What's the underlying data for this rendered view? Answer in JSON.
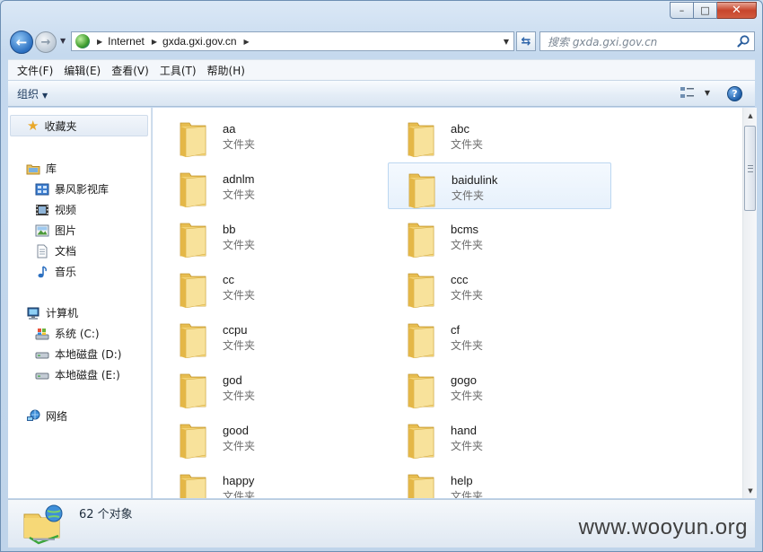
{
  "window": {
    "controls": {
      "minimize": "–",
      "maximize": "□",
      "close": "✕"
    }
  },
  "address": {
    "crumbs": [
      "Internet",
      "gxda.gxi.gov.cn"
    ],
    "search_placeholder": "搜索 gxda.gxi.gov.cn"
  },
  "menu": [
    "文件(F)",
    "编辑(E)",
    "查看(V)",
    "工具(T)",
    "帮助(H)"
  ],
  "toolbar": {
    "organize_label": "组织"
  },
  "navpane": {
    "favorites": "收藏夹",
    "libraries": {
      "label": "库",
      "items": [
        "暴风影视库",
        "视频",
        "图片",
        "文档",
        "音乐"
      ]
    },
    "computer": {
      "label": "计算机",
      "items": [
        "系统 (C:)",
        "本地磁盘 (D:)",
        "本地磁盘 (E:)"
      ]
    },
    "network": "网络"
  },
  "content": {
    "type_label": "文件夹",
    "selected_folder": "baidulink",
    "folders": [
      "aa",
      "abc",
      "adnlm",
      "baidulink",
      "bb",
      "bcms",
      "cc",
      "ccc",
      "ccpu",
      "cf",
      "god",
      "gogo",
      "good",
      "hand",
      "happy",
      "help"
    ]
  },
  "details": {
    "count_text": "62 个对象"
  },
  "watermark": "www.wooyun.org",
  "colors": {
    "accent": "#2b6fc0",
    "selection": "#e7f1fc",
    "folder": "#f3cf6a"
  }
}
